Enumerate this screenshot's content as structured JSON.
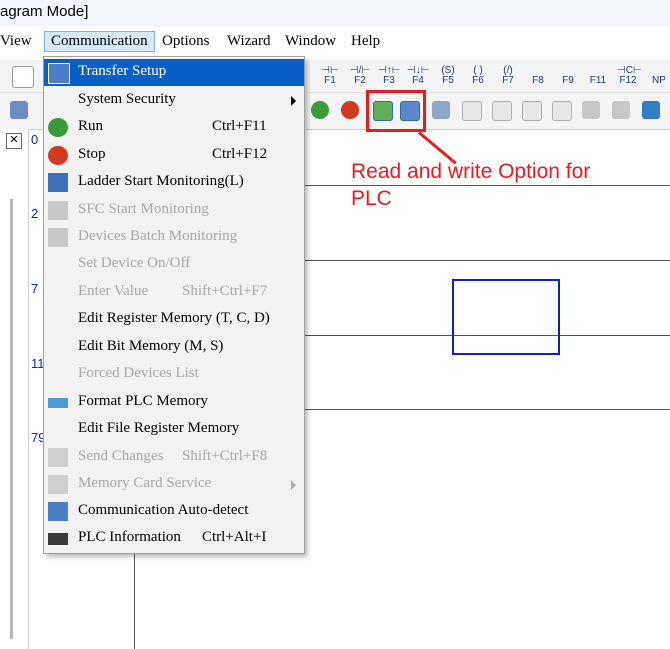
{
  "window": {
    "title_fragment": "agram Mode]"
  },
  "menubar": {
    "items": [
      "View",
      "Communication",
      "Options",
      "Wizard",
      "Window",
      "Help"
    ]
  },
  "toolbar_fkeys": [
    "F1",
    "F2",
    "F3",
    "F4",
    "F5",
    "F6",
    "F7",
    "F8",
    "F9",
    "F11",
    "F12",
    "NP"
  ],
  "toolbar_fkey_symbols": [
    "⊣⊢",
    "⊣/⊢",
    "⊣↑⊢",
    "⊣↓⊢",
    "(S)",
    "( )",
    "(/)",
    "",
    "",
    "",
    "⊣C⊢",
    ""
  ],
  "dropdown": {
    "items": [
      {
        "label": "Transfer Setup",
        "shortcut": "",
        "enabled": true,
        "icon": "transfer-setup-icon"
      },
      {
        "label": "System Security",
        "shortcut": "",
        "enabled": true,
        "submenu": true
      },
      {
        "label": "Run",
        "shortcut": "Ctrl+F11",
        "enabled": true,
        "icon": "run-icon"
      },
      {
        "label": "Stop",
        "shortcut": "Ctrl+F12",
        "enabled": true,
        "icon": "stop-icon"
      },
      {
        "label": "Ladder Start Monitoring(L)",
        "shortcut": "",
        "enabled": true,
        "icon": "ladder-monitor-icon"
      },
      {
        "label": "SFC Start Monitoring",
        "shortcut": "",
        "enabled": false,
        "icon": "sfc-monitor-icon"
      },
      {
        "label": "Devices Batch Monitoring",
        "shortcut": "",
        "enabled": false,
        "icon": "batch-monitor-icon"
      },
      {
        "label": "Set Device On/Off",
        "shortcut": "",
        "enabled": false
      },
      {
        "label": "Enter Value",
        "shortcut": "Shift+Ctrl+F7",
        "enabled": false
      },
      {
        "label": "Edit Register Memory (T, C, D)",
        "shortcut": "",
        "enabled": true
      },
      {
        "label": "Edit Bit Memory (M, S)",
        "shortcut": "",
        "enabled": true
      },
      {
        "label": "Forced Devices List",
        "shortcut": "",
        "enabled": false
      },
      {
        "label": "Format PLC Memory",
        "shortcut": "",
        "enabled": true,
        "icon": "format-memory-icon"
      },
      {
        "label": "Edit File Register Memory",
        "shortcut": "",
        "enabled": true
      },
      {
        "label": "Send Changes",
        "shortcut": "Shift+Ctrl+F8",
        "enabled": false,
        "icon": "send-changes-icon"
      },
      {
        "label": "Memory Card Service",
        "shortcut": "",
        "enabled": false,
        "submenu": true,
        "icon": "memory-card-icon"
      },
      {
        "label": "Communication Auto-detect",
        "shortcut": "",
        "enabled": true,
        "icon": "auto-detect-icon"
      },
      {
        "label": "PLC Information",
        "shortcut": "Ctrl+Alt+I",
        "enabled": true,
        "icon": "plc-info-icon"
      }
    ]
  },
  "ladder": {
    "rung_numbers": [
      "0",
      "2",
      "7",
      "11",
      "79"
    ]
  },
  "annotation": {
    "line1": "Read and write Option for",
    "line2": "PLC"
  },
  "colors": {
    "highlight": "#0a5ec8",
    "annotation": "#e51c23",
    "selection": "#1020c8"
  }
}
